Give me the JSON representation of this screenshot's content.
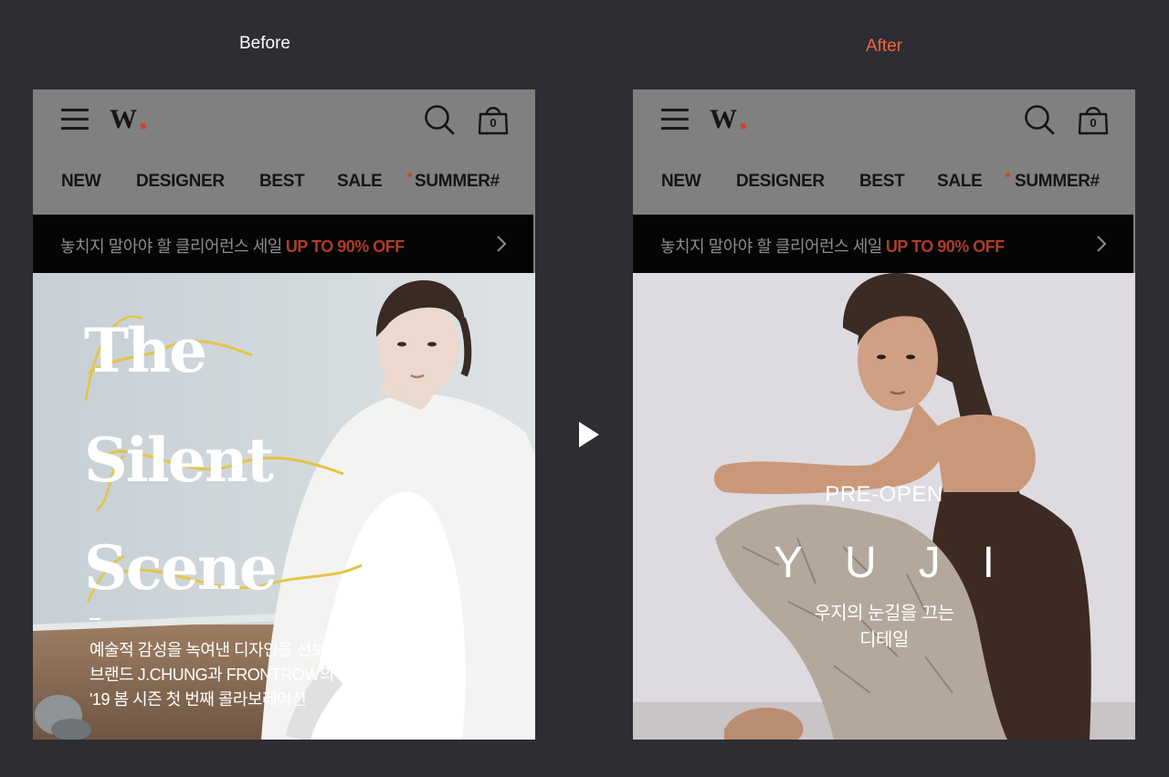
{
  "captions": {
    "before": "Before",
    "after": "After"
  },
  "header": {
    "logo": "W",
    "cart_count": "0",
    "nav": [
      "NEW",
      "DESIGNER",
      "BEST",
      "SALE",
      "SUMMER#"
    ]
  },
  "banner": {
    "text": "놓치지 말아야 할 클리어런스 세일",
    "highlight": "UP TO 90% OFF"
  },
  "before_hero": {
    "title_lines": [
      "The",
      "Silent",
      "Scene"
    ],
    "description": [
      "예술적 감성을 녹여낸 디자인을 선보이는",
      "브랜드 J.CHUNG과 FRONTROW의",
      "'19 봄 시즌 첫 번째 콜라보레이션"
    ]
  },
  "after_hero": {
    "kicker": "PRE-OPEN",
    "title": "YUJI",
    "subtitle": [
      "우지의 눈길을 끄는",
      "디테일"
    ]
  },
  "colors": {
    "background": "#2d2d33",
    "after_caption": "#f0663a",
    "accent_red": "#d2412d",
    "sale_highlight": "#b03c2a",
    "banner_bg": "#050505",
    "header_bg": "#808080"
  },
  "icons": [
    "menu-icon",
    "search-icon",
    "shopping-bag-icon",
    "chevron-right-icon",
    "play-arrow-icon"
  ]
}
